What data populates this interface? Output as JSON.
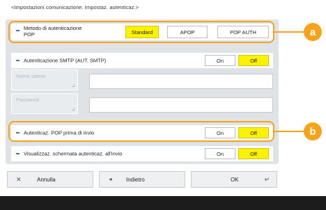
{
  "screen": {
    "title": "<Impostazioni comunicazione: Impostaz. autenticaz.>"
  },
  "settings": {
    "pop_auth_method": {
      "label_line1": "Metodo di autenticazione",
      "label_line2": "POP",
      "options": [
        "Standard",
        "APOP",
        "POP AUTH"
      ],
      "selected": "Standard"
    },
    "smtp_auth": {
      "label": "Autenticazione SMTP (AUT. SMTP)",
      "on_label": "On",
      "off_label": "Off",
      "selected": "Off"
    },
    "username_field": {
      "label": "Nome utente",
      "value": ""
    },
    "password_field": {
      "label": "Password",
      "value": ""
    },
    "pop_before_send": {
      "label": "Autenticaz. POP prima di invio",
      "on_label": "On",
      "off_label": "Off",
      "selected": "Off"
    },
    "show_auth_screen": {
      "label": "Visualizzaz. schermata autenticaz. all'invio",
      "on_label": "On",
      "off_label": "Off",
      "selected": "Off"
    }
  },
  "callouts": {
    "a": "a",
    "b": "b"
  },
  "footer": {
    "cancel": "Annulla",
    "back": "Indietro",
    "ok": "OK"
  },
  "colors": {
    "selected": "#fff200",
    "callout": "#f6a21a",
    "bullet": "#3f77b5"
  },
  "icons": {
    "cancel": "close-icon",
    "back": "back-arrow-icon",
    "ok": "enter-icon"
  }
}
